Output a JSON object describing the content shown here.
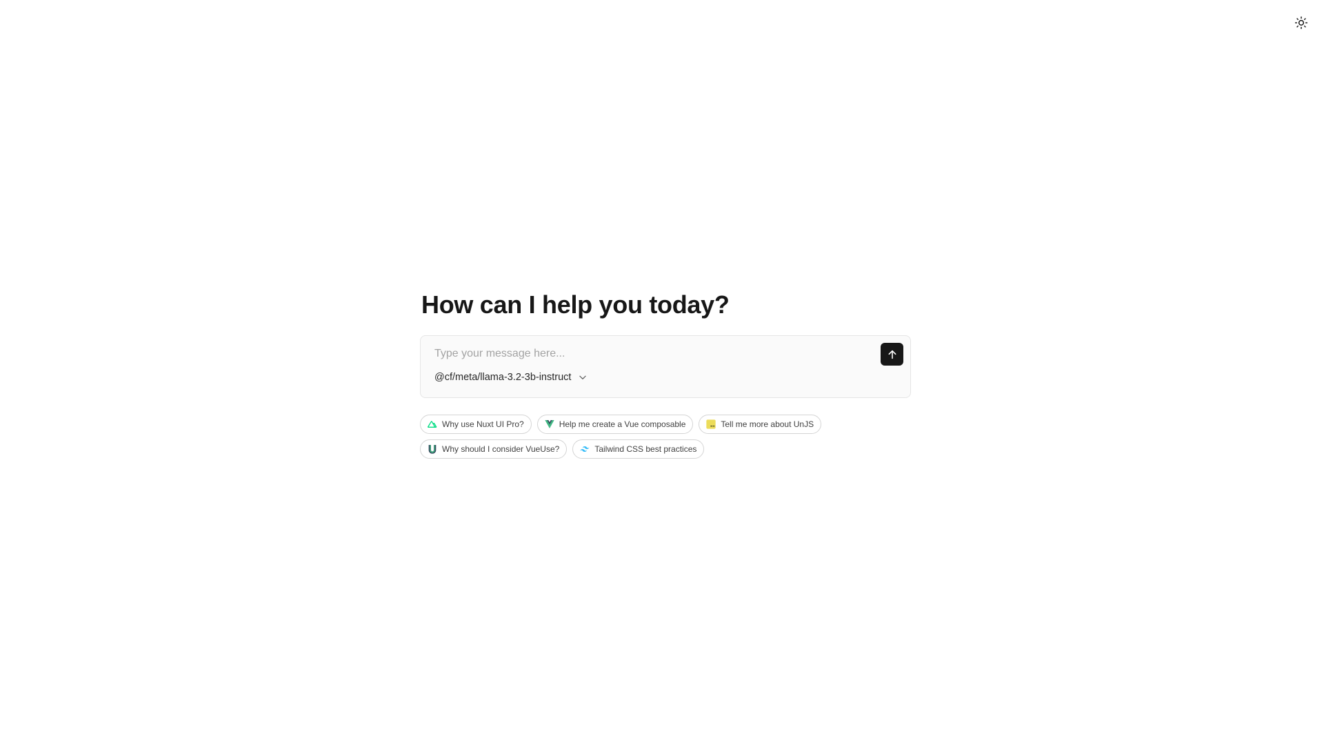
{
  "header": {
    "theme_toggle_icon": "sun-icon"
  },
  "main": {
    "headline": "How can I help you today?",
    "input": {
      "placeholder": "Type your message here...",
      "value": ""
    },
    "send_icon": "arrow-up-icon",
    "model_select": {
      "value": "@cf/meta/llama-3.2-3b-instruct",
      "icon": "chevron-down-icon"
    },
    "suggestions": [
      {
        "label": "Why use Nuxt UI Pro?",
        "icon": "nuxt-icon"
      },
      {
        "label": "Help me create a Vue composable",
        "icon": "vue-icon"
      },
      {
        "label": "Tell me more about UnJS",
        "icon": "unjs-icon"
      },
      {
        "label": "Why should I consider VueUse?",
        "icon": "vueuse-icon"
      },
      {
        "label": "Tailwind CSS best practices",
        "icon": "tailwind-icon"
      }
    ]
  },
  "colors": {
    "background": "#ffffff",
    "text": "#171717",
    "composer_bg": "#fafafa",
    "send_button_bg": "#171717",
    "nuxt_green": "#00dc82",
    "vue_green": "#41b883",
    "vue_dark": "#35495e",
    "unjs_yellow": "#ecdc5a",
    "tailwind_cyan": "#38bdf8"
  }
}
